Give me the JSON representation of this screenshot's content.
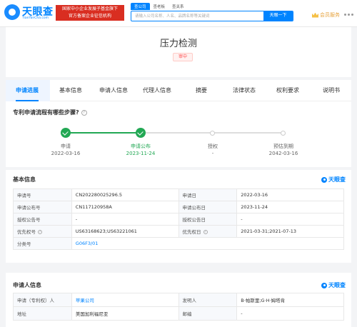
{
  "header": {
    "logo_text": "天眼查",
    "logo_sub": "TianYanCha.com",
    "gov_badge_line1": "国家中小企业发展子基金旗下",
    "gov_badge_line2": "官方备案企业征信机构",
    "search_tabs": [
      "查公司",
      "查老板",
      "查关系"
    ],
    "search_placeholder": "请输入公司名称、人名、品牌名称等关键词",
    "search_button": "天眼一下",
    "vip_label": "会员服务"
  },
  "patent": {
    "title": "压力检测",
    "status": "审中"
  },
  "tabs": [
    "申请进展",
    "基本信息",
    "申请人信息",
    "代理人信息",
    "摘要",
    "法律状态",
    "权利要求",
    "说明书"
  ],
  "process": {
    "question": "专利申请流程有哪些步骤?",
    "steps": [
      {
        "label": "申请",
        "date": "2022-03-16",
        "state": "done"
      },
      {
        "label": "申请公布",
        "date": "2023-11-24",
        "state": "done"
      },
      {
        "label": "授权",
        "date": "-",
        "state": "todo"
      },
      {
        "label": "预估到期",
        "date": "2042-03-16",
        "state": "todo"
      }
    ]
  },
  "basic_info": {
    "title": "基本信息",
    "brand": "天眼查",
    "rows": [
      {
        "k1": "申请号",
        "v1": "CN202280025296.5",
        "k2": "申请日",
        "v2": "2022-03-16"
      },
      {
        "k1": "申请公布号",
        "v1": "CN117120958A",
        "k2": "申请公布日",
        "v2": "2023-11-24"
      },
      {
        "k1": "授权公告号",
        "v1": "-",
        "k2": "授权公告日",
        "v2": "-"
      },
      {
        "k1": "优先权号",
        "v1": "US63168623;US63221061",
        "k2": "优先权日",
        "v2": "2021-03-31;2021-07-13"
      },
      {
        "k1": "分类号",
        "v1": "G06F3/01"
      }
    ]
  },
  "applicant_info": {
    "title": "申请人信息",
    "brand": "天眼查",
    "rows": [
      {
        "k1": "申请（专利权）人",
        "v1": "苹果公司",
        "k2": "发明人",
        "v2": "B·帕斯里;G·H·姆塔肯"
      },
      {
        "k1": "地址",
        "v1": "美国加利福尼亚",
        "k2": "邮编",
        "v2": "-"
      }
    ]
  },
  "colors": {
    "accent": "#0084ff",
    "done_green": "#22a854",
    "status_red": "#ff4d4f"
  }
}
